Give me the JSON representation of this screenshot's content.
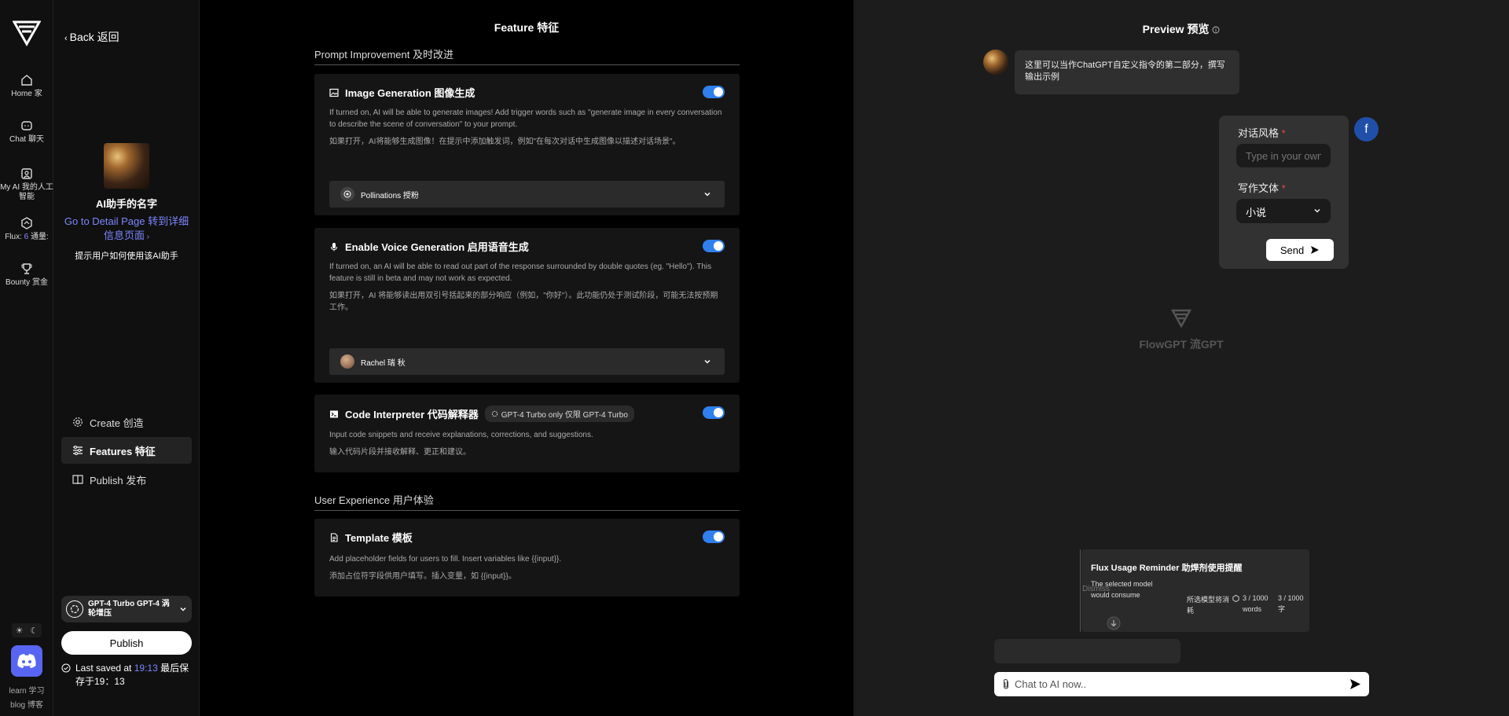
{
  "rail": {
    "items": [
      {
        "label": "Home 家",
        "icon": "home-icon"
      },
      {
        "label": "Chat 聊天",
        "icon": "chat-icon"
      },
      {
        "label": "My AI 我的人工智能",
        "icon": "user-icon"
      },
      {
        "label_a": "Flux: ",
        "label_num": "6",
        "label_b": " 通量:",
        "icon": "flux-icon"
      },
      {
        "label": "Bounty 赏金",
        "icon": "trophy-icon"
      }
    ],
    "learn": "learn 学习",
    "blog": "blog 博客"
  },
  "sidebar": {
    "back": "Back 返回",
    "ai_name": "AI助手的名字",
    "detail_link": "Go to Detail Page 转到详细信息页面",
    "hint": "提示用户如何使用该AI助手",
    "menu": [
      {
        "label": "Create 创造",
        "icon": "gear-icon"
      },
      {
        "label": "Features 特征",
        "icon": "sliders-icon"
      },
      {
        "label": "Publish 发布",
        "icon": "book-icon"
      }
    ],
    "model": "GPT-4 Turbo GPT-4 涡轮增压",
    "publish": "Publish",
    "last_saved_prefix": "Last saved at ",
    "last_saved_time": "19:13",
    "last_saved_suffix": " 最后保存于19：13"
  },
  "main": {
    "title": "Feature 特征",
    "section1": "Prompt Improvement 及时改进",
    "section2": "User Experience 用户体验",
    "image_gen": {
      "title": "Image Generation 图像生成",
      "desc_en": "If turned on, AI will be able to generate images! Add trigger words such as \"generate image in every conversation to describe the scene of conversation\" to your prompt.",
      "desc_zh": "如果打开，AI将能够生成图像！在提示中添加触发词，例如\"在每次对话中生成图像以描述对话场景\"。",
      "dropdown": "Pollinations 授粉"
    },
    "voice_gen": {
      "title": "Enable Voice Generation 启用语音生成",
      "desc_en": "If turned on, an AI will be able to read out part of the response surrounded by double quotes (eg. \"Hello\"). This feature is still in beta and may not work as expected.",
      "desc_zh": "如果打开，AI 将能够读出用双引号括起来的部分响应（例如，\"你好\"）。此功能仍处于测试阶段，可能无法按预期工作。",
      "dropdown": "Rachel 瑞 秋"
    },
    "code_interp": {
      "title": "Code Interpreter 代码解释器",
      "badge": "GPT-4 Turbo only 仅限 GPT-4 Turbo",
      "desc_en": "Input code snippets and receive explanations, corrections, and suggestions.",
      "desc_zh": "输入代码片段并接收解释、更正和建议。"
    },
    "template": {
      "title": "Template 模板",
      "desc_en": "Add placeholder fields for users to fill. Insert variables like {{input}}.",
      "desc_zh": "添加占位符字段供用户填写。插入变量，如 {{input}}。"
    }
  },
  "preview": {
    "title": "Preview 预览",
    "bot_message": "这里可以当作ChatGPT自定义指令的第二部分，撰写输出示例",
    "user_initial": "f",
    "form": {
      "style_label": "对话风格",
      "style_placeholder": "Type in your own",
      "genre_label": "写作文体",
      "genre_value": "小说",
      "send": "Send"
    },
    "watermark": "FlowGPT 流GPT",
    "reminder": {
      "title": "Flux Usage Reminder 助焊剂使用提醒",
      "a": "The selected model would consume",
      "b": "所选模型将消耗",
      "c": "3 / 1000 words",
      "d": "3 / 1000 字",
      "dismiss": "Dismiss"
    },
    "chat_placeholder": "Chat to AI now.."
  }
}
